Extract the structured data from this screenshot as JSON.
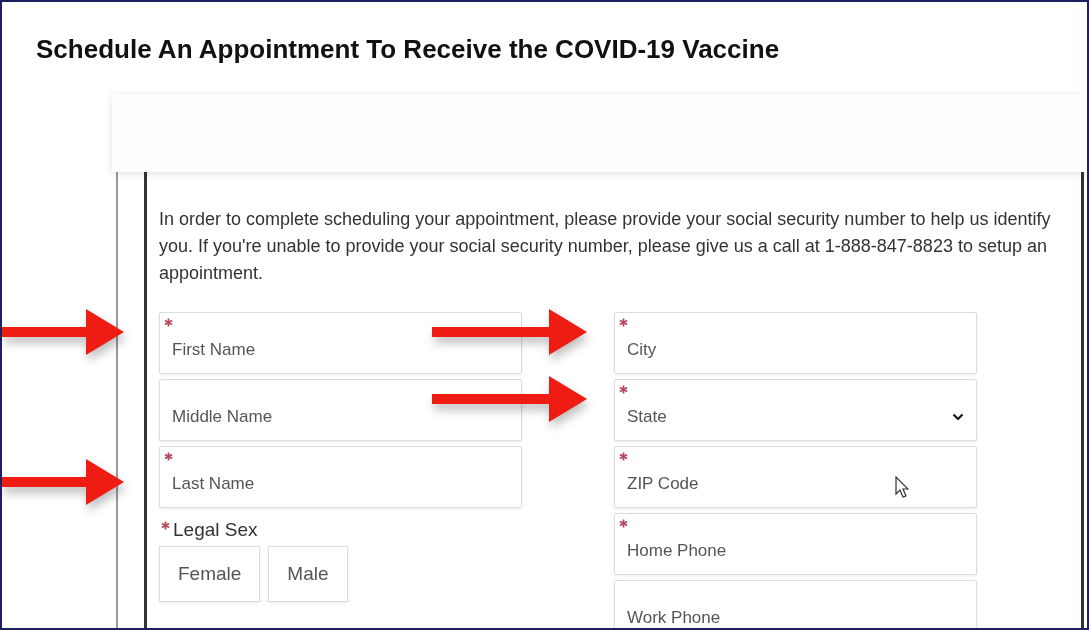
{
  "title": "Schedule An Appointment To Receive the COVID-19 Vaccine",
  "notice": "In order to complete scheduling your appointment, please provide your social security number to help us identify you. If you're unable to provide your social security number, please give us a call at 1-888-847-8823 to setup an appointment.",
  "left_fields": [
    {
      "kind": "text",
      "placeholder": "First Name",
      "required": true
    },
    {
      "kind": "text",
      "placeholder": "Middle Name",
      "required": false
    },
    {
      "kind": "text",
      "placeholder": "Last Name",
      "required": true
    }
  ],
  "legal_sex": {
    "label": "Legal Sex",
    "required": true,
    "options": [
      {
        "label": "Female",
        "selected": false
      },
      {
        "label": "Male",
        "selected": false
      }
    ]
  },
  "right_fields": [
    {
      "kind": "text",
      "placeholder": "City",
      "required": true
    },
    {
      "kind": "select",
      "placeholder": "State",
      "required": true
    },
    {
      "kind": "text",
      "placeholder": "ZIP Code",
      "required": true
    },
    {
      "kind": "text",
      "placeholder": "Home Phone",
      "required": true
    },
    {
      "kind": "text",
      "placeholder": "Work Phone",
      "required": false
    }
  ]
}
